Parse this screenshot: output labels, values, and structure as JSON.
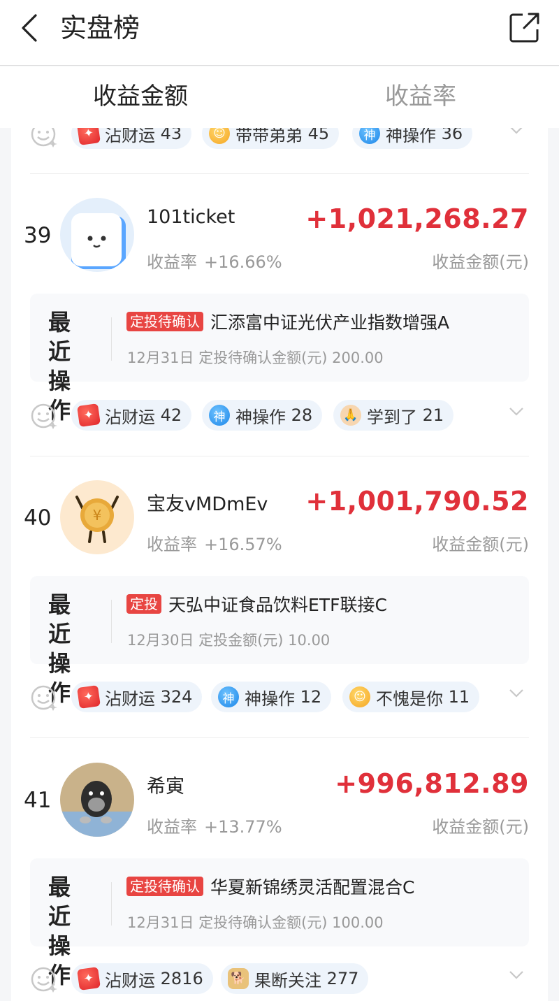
{
  "nav": {
    "title": "实盘榜"
  },
  "tabs": [
    {
      "label": "收益金额",
      "active": true
    },
    {
      "label": "收益率",
      "active": false
    }
  ],
  "top_reactions": [
    {
      "icon": "lucky-icon",
      "label": "沾财运",
      "count": "43"
    },
    {
      "icon": "smile-face-icon",
      "label": "带带弟弟",
      "count": "45"
    },
    {
      "icon": "god-icon",
      "label": "神操作",
      "count": "36"
    }
  ],
  "entries": [
    {
      "rank": "39",
      "name": "101ticket",
      "ratio_label": "收益率",
      "ratio": "+16.66%",
      "amount": "+1,021,268.27",
      "amount_label": "收益金额(元)",
      "op_title": "最近操作",
      "op_title_line1": "最近",
      "op_title_line2": "操作",
      "op_badge": "定投待确认",
      "op_fund": "汇添富中证光伏产业指数增强A",
      "op_detail": "12月31日 定投待确认金额(元) 200.00",
      "reactions": [
        {
          "icon": "lucky-icon",
          "label": "沾财运",
          "count": "42"
        },
        {
          "icon": "god-icon",
          "label": "神操作",
          "count": "28"
        },
        {
          "icon": "clap-hands-icon",
          "label": "学到了",
          "count": "21"
        }
      ]
    },
    {
      "rank": "40",
      "name": "宝友vMDmEv",
      "ratio_label": "收益率",
      "ratio": "+16.57%",
      "amount": "+1,001,790.52",
      "amount_label": "收益金额(元)",
      "op_title_line1": "最近",
      "op_title_line2": "操作",
      "op_badge": "定投",
      "op_fund": "天弘中证食品饮料ETF联接C",
      "op_detail": "12月30日 定投金额(元) 10.00",
      "reactions": [
        {
          "icon": "lucky-icon",
          "label": "沾财运",
          "count": "324"
        },
        {
          "icon": "god-icon",
          "label": "神操作",
          "count": "12"
        },
        {
          "icon": "thinking-face-icon",
          "label": "不愧是你",
          "count": "11"
        }
      ]
    },
    {
      "rank": "41",
      "name": "希寅",
      "ratio_label": "收益率",
      "ratio": "+13.77%",
      "amount": "+996,812.89",
      "amount_label": "收益金额(元)",
      "op_title_line1": "最近",
      "op_title_line2": "操作",
      "op_badge": "定投待确认",
      "op_fund": "华夏新锦绣灵活配置混合C",
      "op_detail": "12月31日 定投待确认金额(元) 100.00",
      "reactions": [
        {
          "icon": "lucky-icon",
          "label": "沾财运",
          "count": "2816"
        },
        {
          "icon": "doge-icon",
          "label": "果断关注",
          "count": "277"
        }
      ]
    }
  ],
  "god_icon_text": "神",
  "colors": {
    "accent_red": "#e0303a",
    "badge_red": "#e84542",
    "chip_bg": "#eef4fb"
  }
}
